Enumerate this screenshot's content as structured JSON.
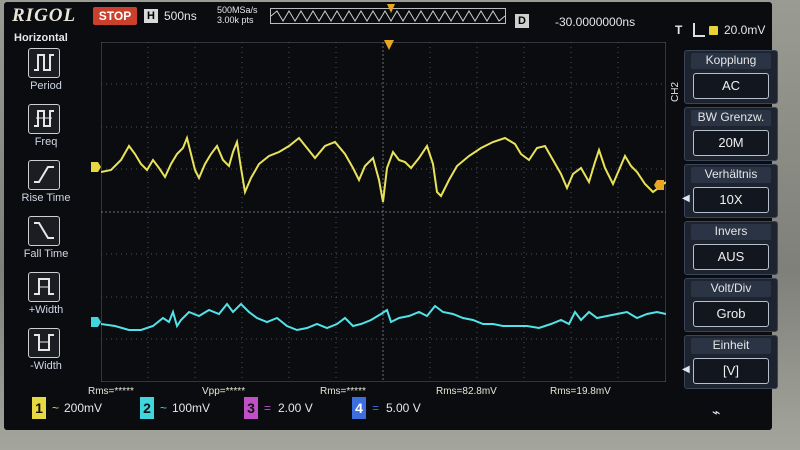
{
  "header": {
    "brand": "RIGOL",
    "run_state": "STOP",
    "timebase_label": "H",
    "timebase": "500ns",
    "sample_rate": "500MSa/s",
    "memory_depth": "3.00k pts",
    "delay_label": "D",
    "delay": "-30.0000000ns",
    "trigger_label": "T",
    "trigger_level": "20.0mV"
  },
  "left_menu": {
    "title": "Horizontal",
    "items": [
      {
        "label": "Period",
        "icon": "period-icon"
      },
      {
        "label": "Freq",
        "icon": "frequency-icon"
      },
      {
        "label": "Rise Time",
        "icon": "rise-time-icon"
      },
      {
        "label": "Fall Time",
        "icon": "fall-time-icon"
      },
      {
        "label": "+Width",
        "icon": "positive-width-icon"
      },
      {
        "label": "-Width",
        "icon": "negative-width-icon"
      }
    ]
  },
  "right_menu": {
    "channel_tag": "CH2",
    "sections": [
      {
        "header": "Kopplung",
        "value": "AC"
      },
      {
        "header": "BW Grenzw.",
        "value": "20M"
      },
      {
        "header": "Verhältnis",
        "value": "10X"
      },
      {
        "header": "Invers",
        "value": "AUS"
      },
      {
        "header": "Volt/Div",
        "value": "Grob"
      },
      {
        "header": "Einheit",
        "value": "[V]"
      }
    ]
  },
  "measurements": [
    {
      "text": "Rms=*****"
    },
    {
      "text": "Vpp=*****"
    },
    {
      "text": "Rms=*****"
    },
    {
      "text": "Rms=82.8mV"
    },
    {
      "text": "Rms=19.8mV"
    }
  ],
  "channels": [
    {
      "number": "1",
      "scale": "200mV",
      "color": "#e7d940",
      "coupling": "~"
    },
    {
      "number": "2",
      "scale": "100mV",
      "color": "#3fd6df",
      "coupling": "~"
    },
    {
      "number": "3",
      "scale": "2.00 V",
      "color": "#c050c8",
      "coupling": "="
    },
    {
      "number": "4",
      "scale": "5.00 V",
      "color": "#3d6ee0",
      "coupling": "="
    }
  ],
  "colors": {
    "ch1_trace": "#e9e35a",
    "ch2_trace": "#52e3e8",
    "grid": "#4b4f57",
    "trigger": "#e8a623",
    "stop": "#c9412d"
  }
}
